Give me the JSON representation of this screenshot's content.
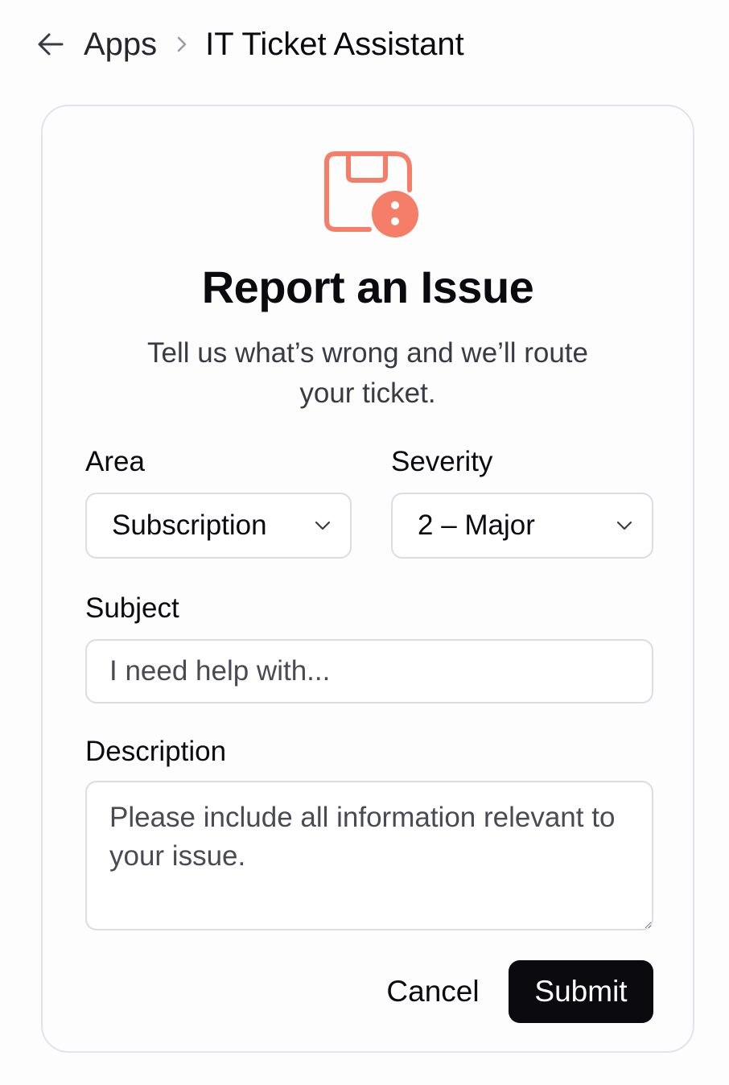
{
  "breadcrumb": {
    "back_icon": "arrow-left-icon",
    "parent": "Apps",
    "separator_icon": "chevron-right-icon",
    "current": "IT Ticket Assistant"
  },
  "card": {
    "icon": "floppy-disk-alert-icon",
    "icon_color": "#f47e67",
    "title": "Report an Issue",
    "subtitle": "Tell us what’s wrong and we’ll route your ticket."
  },
  "form": {
    "area": {
      "label": "Area",
      "value": "Subscription",
      "icon": "chevron-down-icon"
    },
    "severity": {
      "label": "Severity",
      "value": "2 – Major",
      "icon": "chevron-down-icon"
    },
    "subject": {
      "label": "Subject",
      "placeholder": "I need help with..."
    },
    "description": {
      "label": "Description",
      "placeholder": "Please include all information relevant to your issue."
    }
  },
  "actions": {
    "cancel_label": "Cancel",
    "submit_label": "Submit",
    "submit_color": "#0b0b0f"
  }
}
